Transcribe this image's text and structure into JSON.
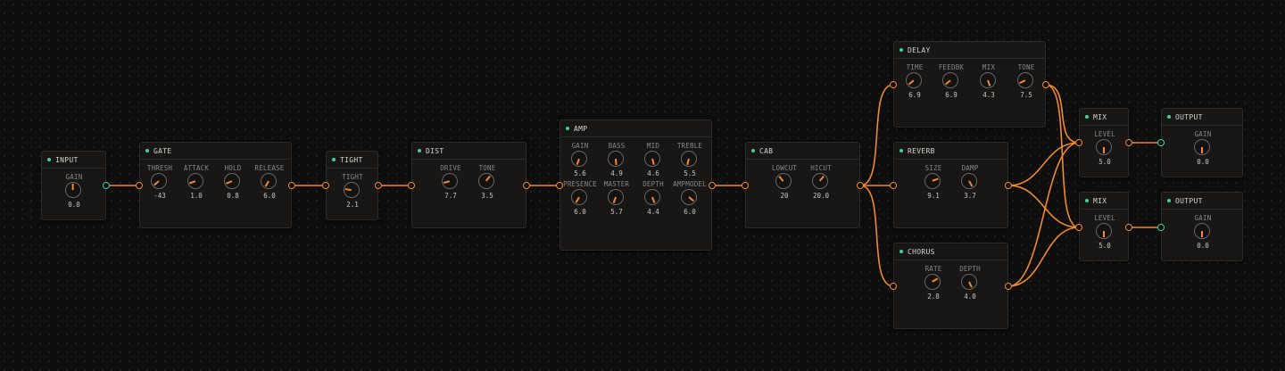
{
  "colors": {
    "wire": "#f28a2e",
    "accent": "#3fd39a",
    "background": "#0e0e0e",
    "node_bg": "#181715"
  },
  "nodes": [
    {
      "id": "input",
      "title": "INPUT",
      "params": [
        {
          "label": "GAIN",
          "value": "0.0",
          "angle": 0
        }
      ]
    },
    {
      "id": "gate",
      "title": "GATE",
      "params": [
        {
          "label": "THRESH",
          "value": "-43",
          "angle": -130
        },
        {
          "label": "ATTACK",
          "value": "1.0",
          "angle": -110
        },
        {
          "label": "HOLD",
          "value": "0.8",
          "angle": -112
        },
        {
          "label": "RELEASE",
          "value": "6.0",
          "angle": -150
        }
      ]
    },
    {
      "id": "tight",
      "title": "TIGHT",
      "params": [
        {
          "label": "TIGHT",
          "value": "2.1",
          "angle": -80
        }
      ]
    },
    {
      "id": "dist",
      "title": "DIST",
      "params": [
        {
          "label": "DRIVE",
          "value": "7.7",
          "angle": -105
        },
        {
          "label": "TONE",
          "value": "3.5",
          "angle": 40
        }
      ]
    },
    {
      "id": "amp",
      "title": "AMP",
      "params": [
        {
          "label": "GAIN",
          "value": "5.6",
          "angle": -160
        },
        {
          "label": "BASS",
          "value": "4.9",
          "angle": 175
        },
        {
          "label": "MID",
          "value": "4.6",
          "angle": 165
        },
        {
          "label": "TREBLE",
          "value": "5.5",
          "angle": -165
        },
        {
          "label": "PRESENCE",
          "value": "6.0",
          "angle": -150
        },
        {
          "label": "MASTER",
          "value": "5.7",
          "angle": -160
        },
        {
          "label": "DEPTH",
          "value": "4.4",
          "angle": 160
        },
        {
          "label": "AMPMODEL",
          "value": "6.0",
          "angle": 130
        }
      ]
    },
    {
      "id": "cab",
      "title": "CAB",
      "params": [
        {
          "label": "LOWCUT",
          "value": "20",
          "angle": -40
        },
        {
          "label": "HICUT",
          "value": "20.0",
          "angle": 40
        }
      ]
    },
    {
      "id": "delay",
      "title": "DELAY",
      "params": [
        {
          "label": "TIME",
          "value": "6.9",
          "angle": -130
        },
        {
          "label": "FEEDBK",
          "value": "6.9",
          "angle": -130
        },
        {
          "label": "MIX",
          "value": "4.3",
          "angle": 160
        },
        {
          "label": "TONE",
          "value": "7.5",
          "angle": -115
        }
      ]
    },
    {
      "id": "reverb",
      "title": "REVERB",
      "params": [
        {
          "label": "SIZE",
          "value": "9.1",
          "angle": 70
        },
        {
          "label": "DAMP",
          "value": "3.7",
          "angle": 150
        }
      ]
    },
    {
      "id": "chorus",
      "title": "CHORUS",
      "params": [
        {
          "label": "RATE",
          "value": "2.8",
          "angle": 60
        },
        {
          "label": "DEPTH",
          "value": "4.0",
          "angle": 155
        }
      ]
    },
    {
      "id": "mix1",
      "title": "MIX",
      "params": [
        {
          "label": "LEVEL",
          "value": "5.0",
          "angle": 180
        }
      ]
    },
    {
      "id": "mix2",
      "title": "MIX",
      "params": [
        {
          "label": "LEVEL",
          "value": "5.0",
          "angle": 180
        }
      ]
    },
    {
      "id": "out1",
      "title": "OUTPUT",
      "params": [
        {
          "label": "GAIN",
          "value": "0.0",
          "angle": 180
        }
      ]
    },
    {
      "id": "out2",
      "title": "OUTPUT",
      "params": [
        {
          "label": "GAIN",
          "value": "0.0",
          "angle": 180
        }
      ]
    }
  ]
}
